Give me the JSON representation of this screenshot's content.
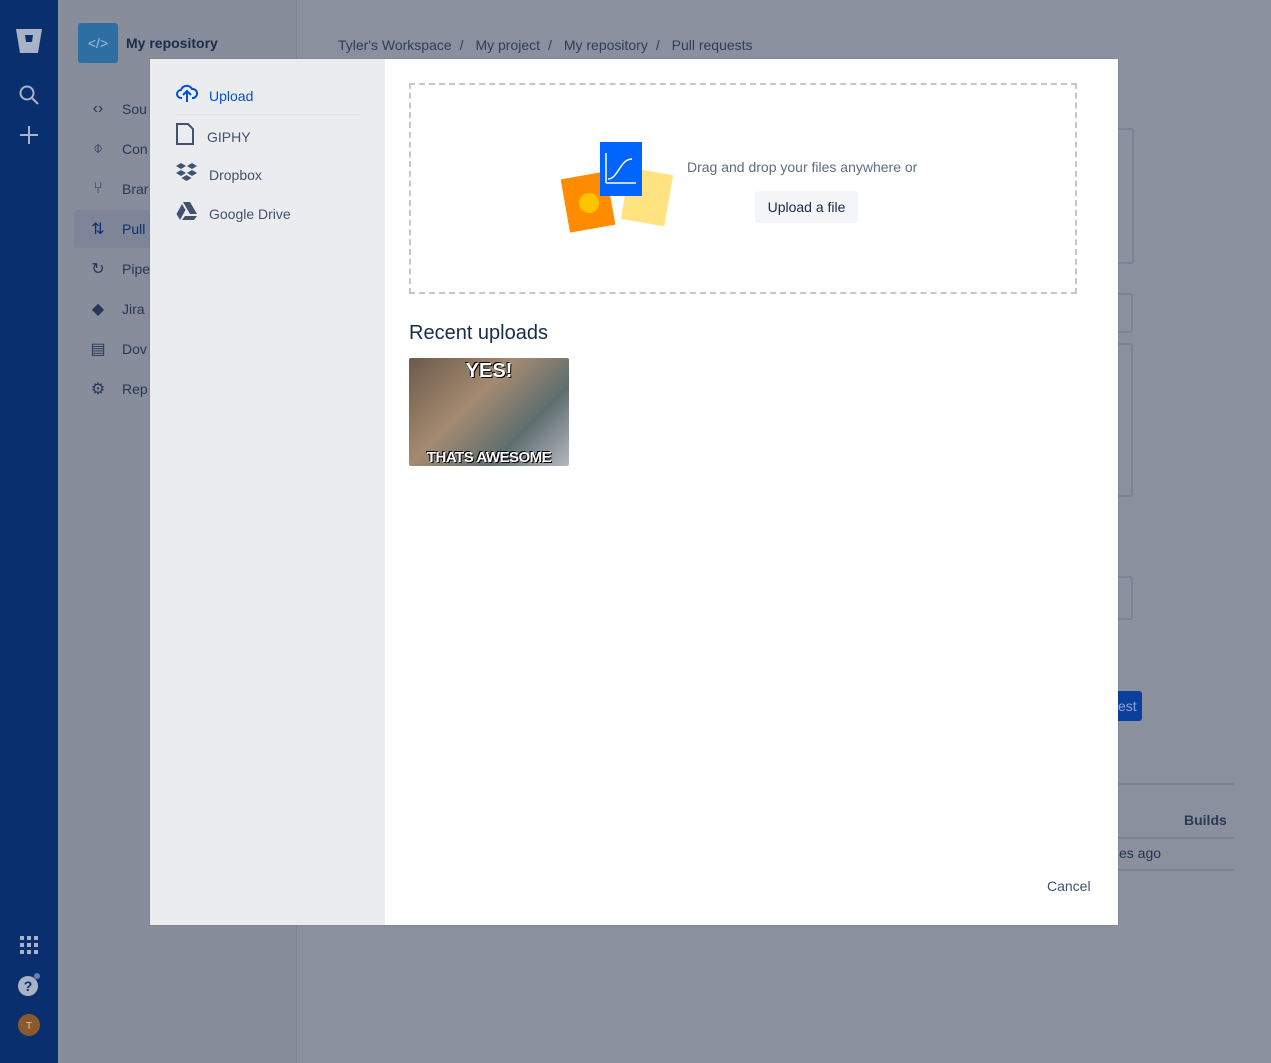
{
  "global_nav": {
    "icons": [
      "bitbucket-logo",
      "search-icon",
      "plus-icon",
      "apps-grid-icon",
      "help-icon",
      "user-avatar"
    ],
    "avatar_initial": "T"
  },
  "repo_sidebar": {
    "name": "My repository",
    "items": [
      {
        "label": "Sou",
        "icon": "code-icon"
      },
      {
        "label": "Con",
        "icon": "commit-icon"
      },
      {
        "label": "Brar",
        "icon": "branch-icon"
      },
      {
        "label": "Pull",
        "icon": "pull-request-icon",
        "active": true
      },
      {
        "label": "Pipe",
        "icon": "pipelines-icon"
      },
      {
        "label": "Jira",
        "icon": "jira-icon"
      },
      {
        "label": "Dov",
        "icon": "document-icon"
      },
      {
        "label": "Rep",
        "icon": "settings-icon"
      }
    ]
  },
  "breadcrumb": [
    "Tyler's Workspace",
    "My project",
    "My repository",
    "Pull requests"
  ],
  "background": {
    "button_fragment": "est",
    "builds_header": "Builds",
    "time_fragment": "es ago"
  },
  "modal": {
    "sources": [
      {
        "label": "Upload",
        "icon": "cloud-upload-icon",
        "active": true
      },
      {
        "label": "GIPHY",
        "icon": "file-icon"
      },
      {
        "label": "Dropbox",
        "icon": "dropbox-icon"
      },
      {
        "label": "Google Drive",
        "icon": "google-drive-icon"
      }
    ],
    "drop_text": "Drag and drop your files anywhere or",
    "upload_button": "Upload a file",
    "recent_title": "Recent uploads",
    "recent": [
      {
        "caption_top": "YES!",
        "caption_bottom": "THATS AWESOME"
      }
    ],
    "cancel": "Cancel"
  }
}
